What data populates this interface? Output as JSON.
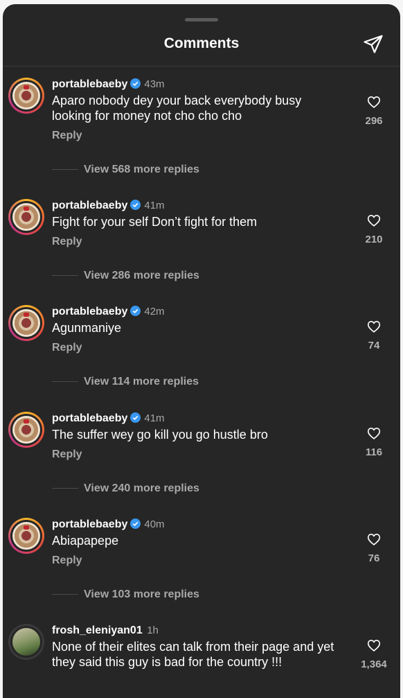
{
  "header": {
    "title": "Comments"
  },
  "comments": [
    {
      "user": "portablebaeby",
      "time": "43m",
      "text": "Aparo nobody dey your back everybody busy looking for money not cho cho cho",
      "reply": "Reply",
      "more": "View 568 more replies",
      "likes": "296",
      "verified": true
    },
    {
      "user": "portablebaeby",
      "time": "41m",
      "text": "Fight for your self Don’t fight for them",
      "reply": "Reply",
      "more": "View 286 more replies",
      "likes": "210",
      "verified": true
    },
    {
      "user": "portablebaeby",
      "time": "42m",
      "text": "Agunmaniye",
      "reply": "Reply",
      "more": "View 114 more replies",
      "likes": "74",
      "verified": true
    },
    {
      "user": "portablebaeby",
      "time": "41m",
      "text": "The suffer wey go kill you go hustle bro",
      "reply": "Reply",
      "more": "View 240 more replies",
      "likes": "116",
      "verified": true
    },
    {
      "user": "portablebaeby",
      "time": "40m",
      "text": "Abiapapepe",
      "reply": "Reply",
      "more": "View 103 more replies",
      "likes": "76",
      "verified": true
    },
    {
      "user": "frosh_eleniyan01",
      "time": "1h",
      "text": "None of their elites can talk from their page and yet they said this guy is bad for the country !!!",
      "reply": "",
      "more": "",
      "likes": "1,364",
      "verified": false
    }
  ],
  "icons": {
    "share": "paper-plane-icon",
    "like": "heart-icon",
    "verified": "verified-badge-icon"
  },
  "colors": {
    "background": "#262626",
    "verified": "#3897f0",
    "text": "#ffffff",
    "muted": "#a8a8a8"
  }
}
